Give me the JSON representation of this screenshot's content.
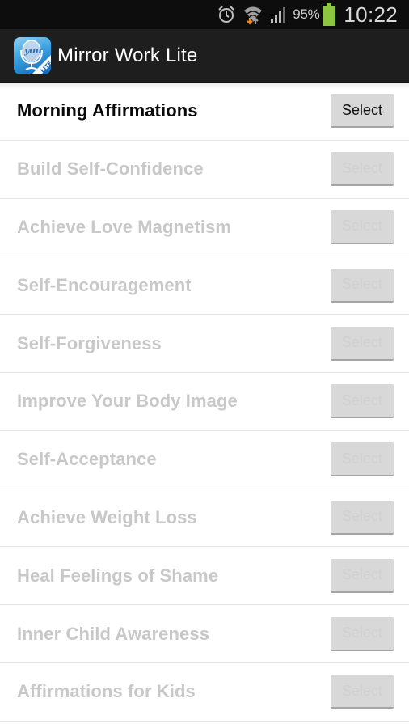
{
  "status_bar": {
    "icons": [
      "alarm-icon",
      "wifi-icon",
      "signal-icon",
      "battery-icon"
    ],
    "battery_percent": "95%",
    "battery_color": "#8cc63f",
    "time": "10:22"
  },
  "action_bar": {
    "app_icon": "mirror-work-lite-logo",
    "app_icon_text": "you",
    "app_icon_badge": "LITE",
    "title": "Mirror Work Lite"
  },
  "affirmations": {
    "select_label": "Select",
    "items": [
      {
        "label": "Morning Affirmations",
        "enabled": true
      },
      {
        "label": "Build Self-Confidence",
        "enabled": false
      },
      {
        "label": "Achieve Love Magnetism",
        "enabled": false
      },
      {
        "label": "Self-Encouragement",
        "enabled": false
      },
      {
        "label": "Self-Forgiveness",
        "enabled": false
      },
      {
        "label": "Improve Your Body Image",
        "enabled": false
      },
      {
        "label": "Self-Acceptance",
        "enabled": false
      },
      {
        "label": "Achieve Weight Loss",
        "enabled": false
      },
      {
        "label": "Heal Feelings of Shame",
        "enabled": false
      },
      {
        "label": "Inner Child Awareness",
        "enabled": false
      },
      {
        "label": "Affirmations for Kids",
        "enabled": false
      }
    ]
  }
}
